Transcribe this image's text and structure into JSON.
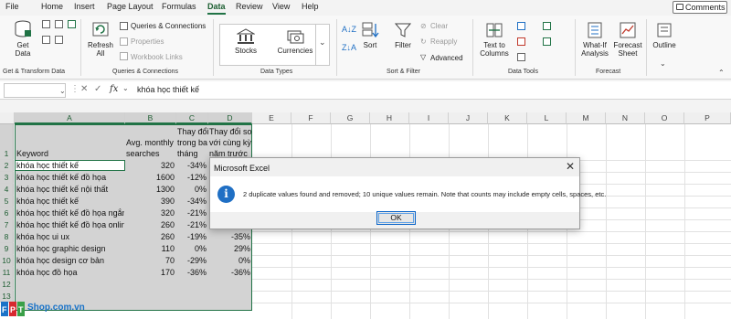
{
  "menu": {
    "items": [
      "File",
      "Home",
      "Insert",
      "Page Layout",
      "Formulas",
      "Data",
      "Review",
      "View",
      "Help"
    ],
    "active": "Data",
    "comments_label": "Comments"
  },
  "ribbon": {
    "get_data": {
      "label_line1": "Get",
      "label_line2": "Data"
    },
    "group_get_transform": "Get & Transform Data",
    "refresh": {
      "label_line1": "Refresh",
      "label_line2": "All"
    },
    "queries_connections": "Queries & Connections",
    "properties": "Properties",
    "workbook_links": "Workbook Links",
    "group_queries": "Queries & Connections",
    "stocks": "Stocks",
    "currencies": "Currencies",
    "group_datatypes": "Data Types",
    "sort": "Sort",
    "filter": "Filter",
    "clear": "Clear",
    "reapply": "Reapply",
    "advanced": "Advanced",
    "group_sortfilter": "Sort & Filter",
    "text_to_columns": {
      "line1": "Text to",
      "line2": "Columns"
    },
    "group_datatools": "Data Tools",
    "whatif": {
      "line1": "What-If",
      "line2": "Analysis"
    },
    "forecast_sheet": {
      "line1": "Forecast",
      "line2": "Sheet"
    },
    "group_forecast": "Forecast",
    "outline": "Outline"
  },
  "formula_bar": {
    "cell_ref": "",
    "content": "khóa học thiết kế"
  },
  "sheet": {
    "columns": [
      "A",
      "B",
      "C",
      "D",
      "E",
      "F",
      "G",
      "H",
      "I",
      "J",
      "K",
      "L",
      "M",
      "N",
      "O",
      "P"
    ],
    "rows": [
      "1",
      "2",
      "3",
      "4",
      "5",
      "6",
      "7",
      "8",
      "9",
      "10",
      "11",
      "12",
      "13"
    ],
    "headers": {
      "A": "Keyword",
      "B_line1": "Avg. monthly",
      "B_line2": "searches",
      "C_line1": "Thay đổi",
      "C_line2": "trong ba",
      "C_line3": "tháng",
      "D_line1": "Thay đổi so",
      "D_line2": "với cùng kỳ",
      "D_line3": "năm trước"
    },
    "data": [
      {
        "a": "khóa học thiết kế",
        "b": "320",
        "c": "-34%",
        "d": ""
      },
      {
        "a": "khóa học thiết kế đồ họa",
        "b": "1600",
        "c": "-12%",
        "d": ""
      },
      {
        "a": "khóa học thiết kế nội thất",
        "b": "1300",
        "c": "0%",
        "d": ""
      },
      {
        "a": "khóa học thiết kế",
        "b": "390",
        "c": "-34%",
        "d": ""
      },
      {
        "a": "khóa học thiết kế đồ họa ngắn",
        "b": "320",
        "c": "-21%",
        "d": ""
      },
      {
        "a": "khóa học thiết kế đồ họa online",
        "b": "260",
        "c": "-21%",
        "d": ""
      },
      {
        "a": "khóa học ui ux",
        "b": "260",
        "c": "-19%",
        "d": "-35%"
      },
      {
        "a": "khóa học graphic design",
        "b": "110",
        "c": "0%",
        "d": "29%"
      },
      {
        "a": "khóa học design cơ bản",
        "b": "70",
        "c": "-29%",
        "d": "0%"
      },
      {
        "a": "khóa học đồ họa",
        "b": "170",
        "c": "-36%",
        "d": "-36%"
      }
    ]
  },
  "dialog": {
    "title": "Microsoft Excel",
    "message": "2 duplicate values found and removed; 10 unique values remain. Note that counts may include empty cells, spaces, etc.",
    "ok_label": "OK",
    "icon": "info-icon"
  },
  "watermark": {
    "brand": "FPT",
    "site": "Shop.com.vn",
    "colors": {
      "red": "#d7282f",
      "blue": "#1a73c8",
      "green": "#3aa048"
    }
  },
  "colors": {
    "accent": "#217346",
    "dialog_button_border": "#0a64c8",
    "info_icon": "#1f6fc4"
  }
}
